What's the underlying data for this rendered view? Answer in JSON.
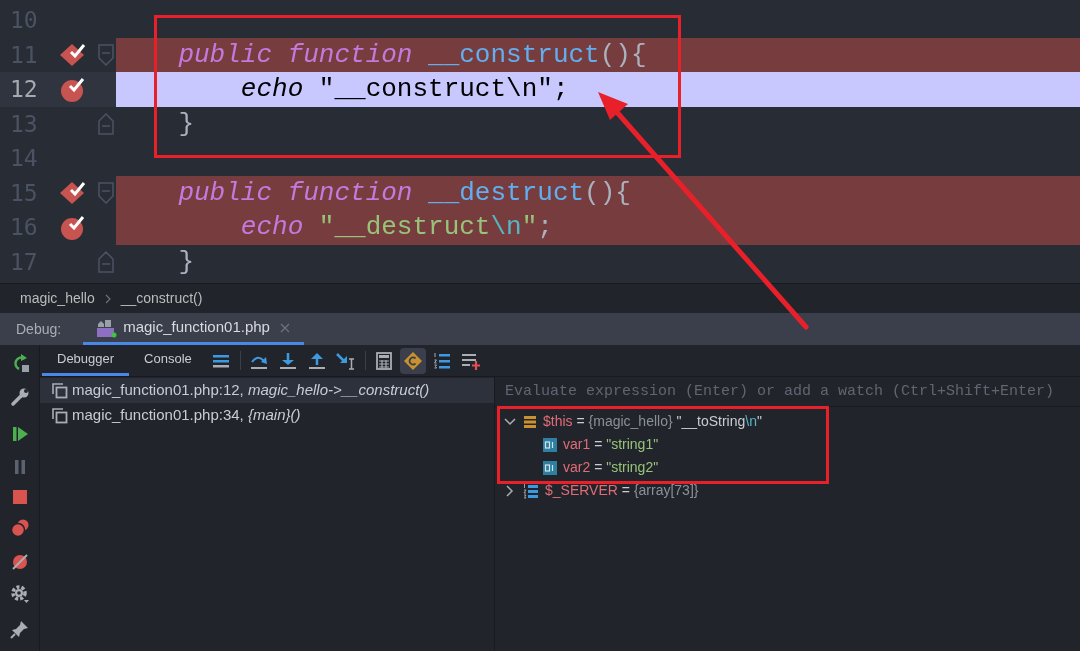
{
  "editor": {
    "lines": [
      {
        "number": "10"
      },
      {
        "number": "11",
        "breakpoint": {
          "kind": "method"
        },
        "fold": {
          "kind": "start"
        },
        "tokens": [
          {
            "text": "    public function",
            "kind": "keyword"
          },
          {
            "text": " __construct",
            "kind": "function"
          },
          {
            "text": "(){",
            "kind": "punct"
          }
        ]
      },
      {
        "number": "12",
        "current": true,
        "breakpoint": {
          "kind": "line"
        },
        "tokens": [
          {
            "text": "        echo",
            "kind": "keyword"
          },
          {
            "text": " \"__construct",
            "kind": "string"
          },
          {
            "text": "\\n",
            "kind": "escape"
          },
          {
            "text": "\"",
            "kind": "string"
          },
          {
            "text": ";",
            "kind": "punct"
          }
        ]
      },
      {
        "number": "13",
        "fold": {
          "kind": "end"
        },
        "tokens": [
          {
            "text": "    }",
            "kind": "punct"
          }
        ]
      },
      {
        "number": "14"
      },
      {
        "number": "15",
        "breakpoint": {
          "kind": "method"
        },
        "fold": {
          "kind": "start"
        },
        "tokens": [
          {
            "text": "    public function",
            "kind": "keyword"
          },
          {
            "text": " __destruct",
            "kind": "function"
          },
          {
            "text": "(){",
            "kind": "punct"
          }
        ]
      },
      {
        "number": "16",
        "breakpoint": {
          "kind": "line"
        },
        "tokens": [
          {
            "text": "        echo",
            "kind": "keyword"
          },
          {
            "text": " \"__destruct",
            "kind": "string"
          },
          {
            "text": "\\n",
            "kind": "escape"
          },
          {
            "text": "\"",
            "kind": "string"
          },
          {
            "text": ";",
            "kind": "punct"
          }
        ]
      },
      {
        "number": "17",
        "fold": {
          "kind": "end"
        },
        "tokens": [
          {
            "text": "    }",
            "kind": "punct"
          }
        ]
      }
    ]
  },
  "breadcrumb": [
    "magic_hello",
    "__construct()"
  ],
  "debug_bar": {
    "label": "Debug:",
    "tabs": [
      {
        "title": "magic_function01.php",
        "selected": true
      }
    ]
  },
  "debug_tabs": [
    {
      "label": "Debugger",
      "selected": true
    },
    {
      "label": "Console",
      "selected": false
    }
  ],
  "toolbar_buttons": [
    {
      "selected": false
    },
    {
      "selected": false
    },
    {
      "selected": false
    },
    {
      "selected": false
    },
    {
      "selected": false
    },
    {
      "selected": false
    },
    {
      "selected": true
    },
    {
      "selected": false
    },
    {
      "selected": false
    }
  ],
  "frames": [
    {
      "label": "magic_function01.php:12, *magic_hello->__construct()*",
      "selected": true
    },
    {
      "label": "magic_function01.php:34, *{main}()*",
      "selected": false
    }
  ],
  "variables": {
    "placeholder": "Evaluate expression (Enter) or add a watch (Ctrl+Shift+Enter)",
    "items": [
      {
        "kind": "object",
        "name": "$this",
        "operator": "=",
        "type": "{magic_hello}",
        "value": [
          {
            "text": "\"__toString",
            "kind": "plain"
          },
          {
            "text": "\\n",
            "kind": "escape"
          },
          {
            "text": "\"",
            "kind": "plain"
          }
        ],
        "expanded": true,
        "children": [
          {
            "kind": "field",
            "name": "var1",
            "operator": "=",
            "value": [
              {
                "text": "\"string1\"",
                "kind": "string"
              }
            ]
          },
          {
            "kind": "field",
            "name": "var2",
            "operator": "=",
            "value": [
              {
                "text": "\"string2\"",
                "kind": "string"
              }
            ]
          }
        ]
      },
      {
        "kind": "array",
        "name": "$_SERVER",
        "operator": "=",
        "type": "{array[73]}",
        "expanded": false
      }
    ]
  }
}
